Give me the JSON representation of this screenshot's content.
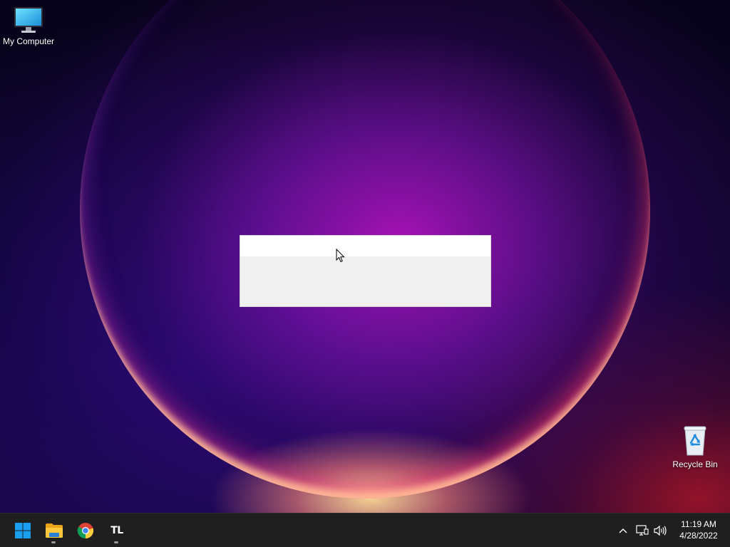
{
  "desktop": {
    "icons": [
      {
        "label": "My Computer",
        "icon": "monitor-icon"
      },
      {
        "label": "Recycle Bin",
        "icon": "recycle-bin-icon"
      }
    ]
  },
  "popup": {
    "title": "",
    "body": ""
  },
  "taskbar": {
    "apps": [
      {
        "name": "Start",
        "icon": "windows-start-icon"
      },
      {
        "name": "File Explorer",
        "icon": "folder-icon",
        "running": true
      },
      {
        "name": "Google Chrome",
        "icon": "chrome-icon"
      },
      {
        "name": "TL",
        "icon": "tl-app-icon",
        "label": "TL",
        "running": true
      }
    ],
    "tray": {
      "icons": [
        "chevron-up-icon",
        "network-icon",
        "volume-icon"
      ],
      "time": "11:19 AM",
      "date": "4/28/2022"
    }
  },
  "colors": {
    "taskbar_bg": "#1f1f1f",
    "popup_bg": "#f0f0f0",
    "start_blue": "#1a9ff0"
  }
}
